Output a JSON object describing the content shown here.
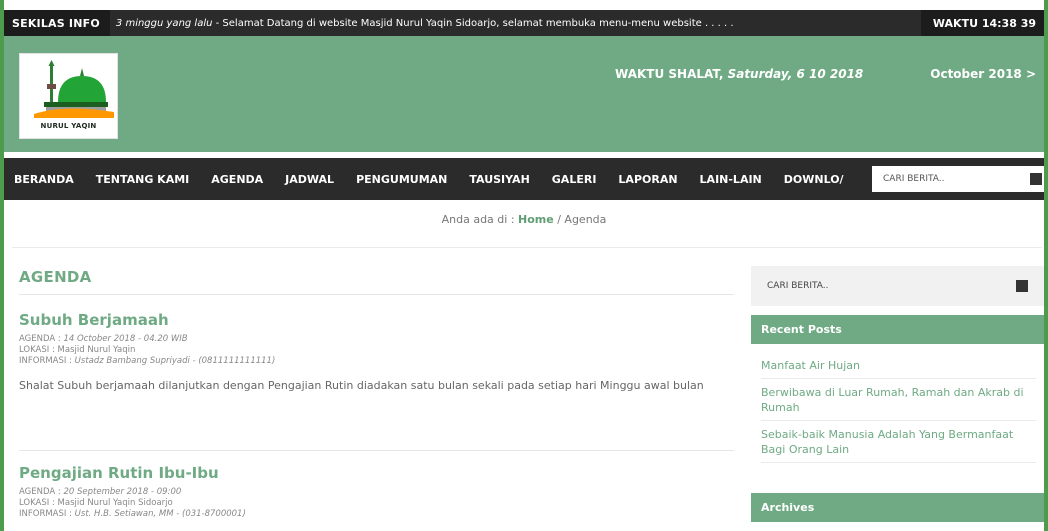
{
  "ticker": {
    "label": "SEKILAS INFO",
    "time_ago": "3 minggu yang lalu",
    "message": " - Selamat Datang di website  Masjid Nurul Yaqin Sidoarjo, selamat membuka menu-menu website . . . . .",
    "clock": "WAKTU 14:38 39"
  },
  "header": {
    "logo_text": "NURUL YAQIN",
    "prayer_label": "WAKTU SHALAT, ",
    "prayer_date": "Saturday, 6 10 2018",
    "month": "October 2018 >"
  },
  "nav": {
    "items": [
      "BERANDA",
      "TENTANG KAMI",
      "AGENDA",
      "JADWAL",
      "PENGUMUMAN",
      "TAUSIYAH",
      "GALERI",
      "LAPORAN",
      "LAIN-LAIN",
      "DOWNLO/"
    ],
    "search_placeholder": "CARI BERITA.."
  },
  "breadcrumb": {
    "prefix": "Anda ada di : ",
    "home": "Home",
    "current": " / Agenda"
  },
  "main": {
    "title": "AGENDA",
    "posts": [
      {
        "title": "Subuh Berjamaah",
        "agenda_label": "AGENDA : ",
        "agenda_value": "14 October 2018 - 04.20 WIB",
        "lokasi": "LOKASI : Masjid Nurul Yaqin",
        "info_label": "INFORMASI : ",
        "info_value": "Ustadz Bambang Supriyadi - (0811111111111)",
        "body": "Shalat Subuh berjamaah dilanjutkan dengan Pengajian Rutin diadakan satu bulan sekali pada setiap hari Minggu awal bulan"
      },
      {
        "title": "Pengajian Rutin Ibu-Ibu",
        "agenda_label": "AGENDA : ",
        "agenda_value": "20 September 2018 - 09:00",
        "lokasi": "LOKASI : Masjid Nurul Yaqin Sidoarjo",
        "info_label": "INFORMASI : ",
        "info_value": "Ust. H.B. Setiawan, MM - (031-8700001)"
      }
    ]
  },
  "sidebar": {
    "search_placeholder": "CARI BERITA..",
    "recent_title": "Recent Posts",
    "recent": [
      "Manfaat Air Hujan",
      "Berwibawa di Luar Rumah, Ramah dan Akrab di Rumah",
      "Sebaik-baik Manusia Adalah Yang Bermanfaat Bagi Orang Lain"
    ],
    "archives_title": "Archives"
  },
  "colors": {
    "accent": "#6faa84",
    "dark_bar": "#2b2b2b",
    "frame": "#4d9c4d"
  }
}
